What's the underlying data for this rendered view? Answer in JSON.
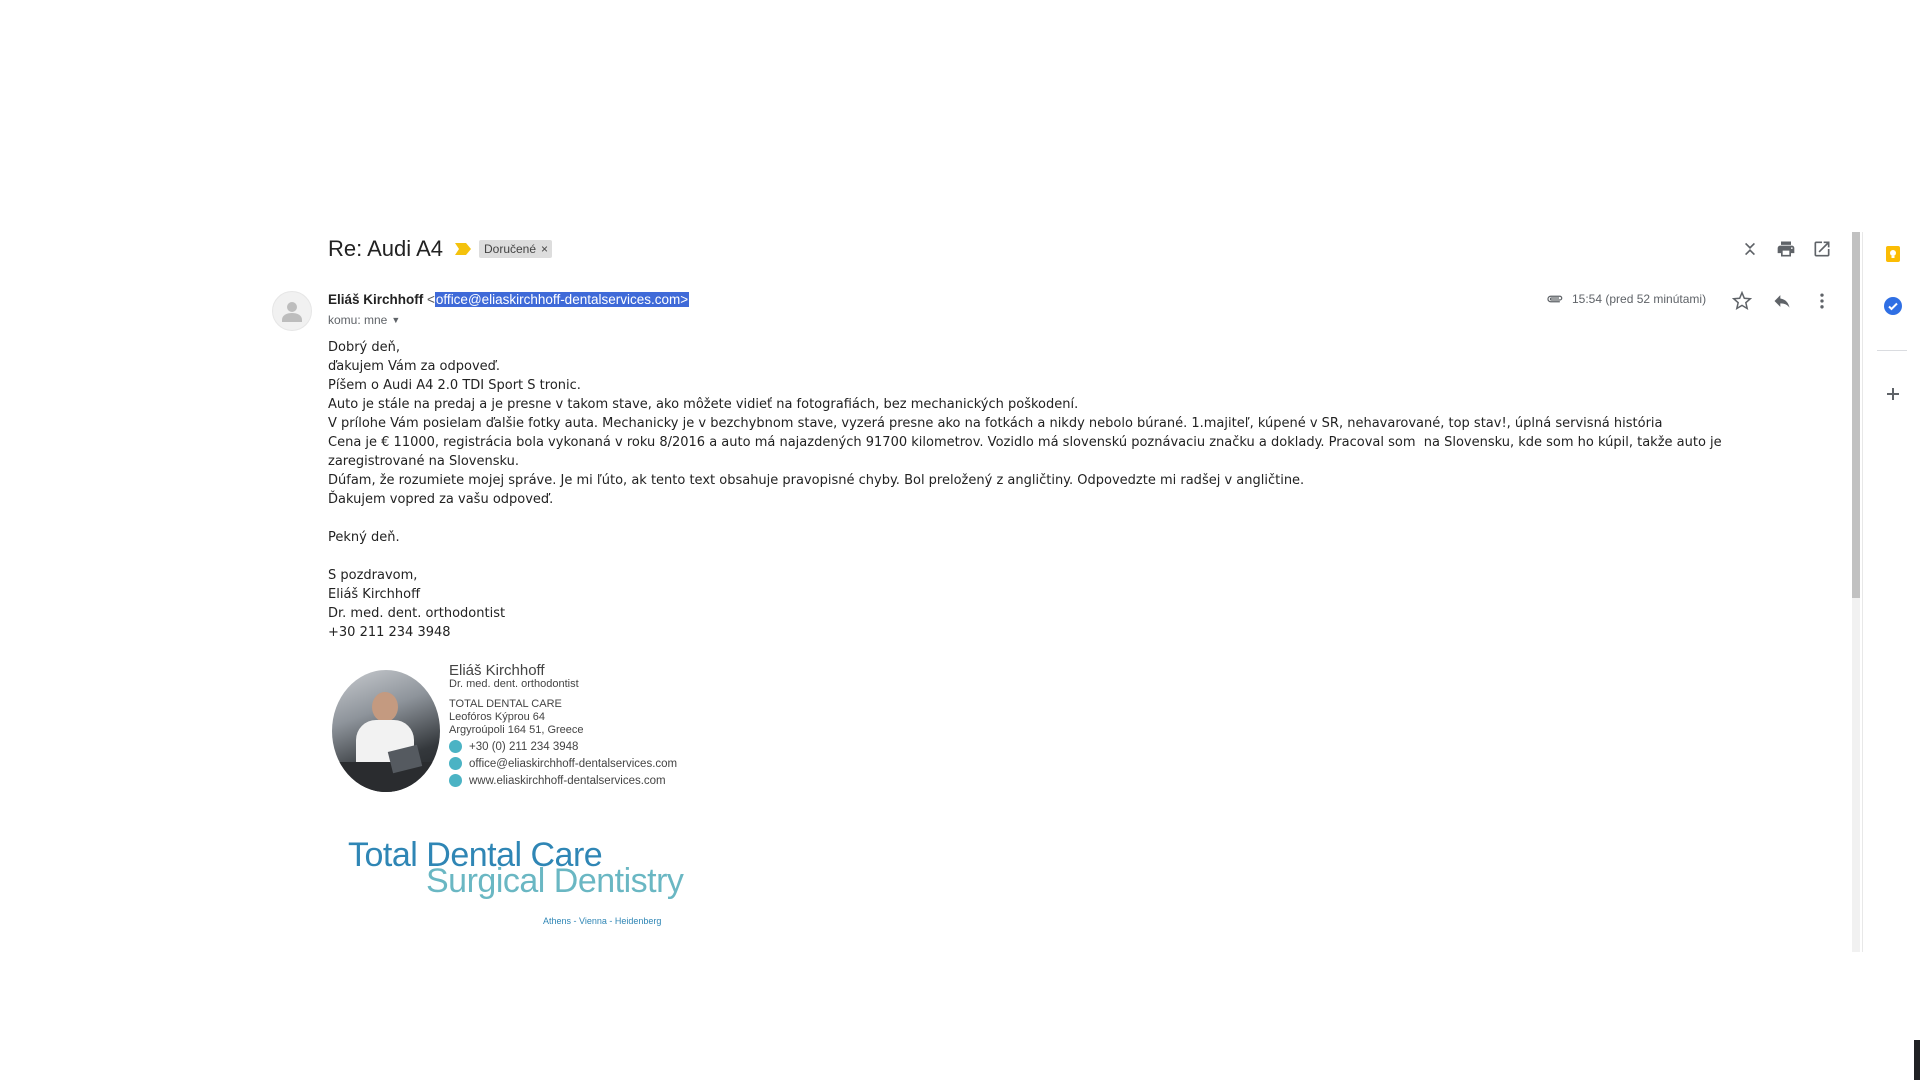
{
  "email": {
    "subject": "Re: Audi A4",
    "label": "Doručené",
    "label_remove": "×",
    "sender_name": "Eliáš Kirchhoff",
    "sender_email_open": "<",
    "sender_email": "office@eliaskirchhoff-dentalservices.com>",
    "to_label": "komu: mne",
    "time": "15:54 (pred 52 minútami)",
    "body": [
      "Dobrý deň,",
      "ďakujem Vám za odpoveď.",
      "Píšem o Audi A4 2.0 TDI Sport S tronic.",
      "Auto je stále na predaj a je presne v takom stave, ako môžete vidieť na fotografiách, bez mechanických poškodení.",
      "V prílohe Vám posielam ďalšie fotky auta. Mechanicky je v bezchybnom stave, vyzerá presne ako na fotkách a nikdy nebolo búrané. 1.majiteľ, kúpené v SR, nehavarované, top stav!, úplná servisná história",
      "Cena je € 11000, registrácia bola vykonaná v roku 8/2016 a auto má najazdených 91700 kilometrov. Vozidlo má slovenskú poznávaciu značku a doklady. Pracoval som  na Slovensku, kde som ho kúpil, takže auto je zaregistrované na Slovensku.",
      "Dúfam, že rozumiete mojej správe. Je mi ľúto, ak tento text obsahuje pravopisné chyby. Bol preložený z angličtiny. Odpovedzte mi radšej v angličtine.",
      "Ďakujem vopred za vašu odpoveď."
    ],
    "greeting": "Pekný deň.",
    "closing": [
      "S pozdravom,",
      "Eliáš Kirchhoff",
      "Dr. med. dent. orthodontist",
      "+30 211 234 3948"
    ]
  },
  "signature": {
    "name": "Eliáš Kirchhoff",
    "title": "Dr. med. dent. orthodontist",
    "company": "TOTAL DENTAL CARE",
    "address1": "Leofóros Kýprou 64",
    "address2": "Argyroúpoli 164 51,  Greece",
    "phone": "+30 (0) 211 234 3948",
    "email": "office@eliaskirchhoff-dentalservices.com",
    "web": "www.eliaskirchhoff-dentalservices.com"
  },
  "logo": {
    "line1": "Total Dental Care",
    "line2": "Surgical Dentistry",
    "cities": "Athens - Vienna - Heidenberg"
  },
  "icons": {
    "collapse": "collapse-all-icon",
    "print": "print-icon",
    "new_window": "open-in-new-window-icon",
    "attachment": "attachment-icon",
    "star": "star-icon",
    "reply": "reply-icon",
    "more": "more-vert-icon",
    "importance": "importance-marker-icon"
  },
  "colors": {
    "selection": "#3f6ad8",
    "importance": "#f4c20d",
    "keep": "#fbbc04",
    "tasks": "#2f6fe4",
    "logo_blue": "#2f86b5",
    "logo_teal": "#5ab0bd"
  }
}
